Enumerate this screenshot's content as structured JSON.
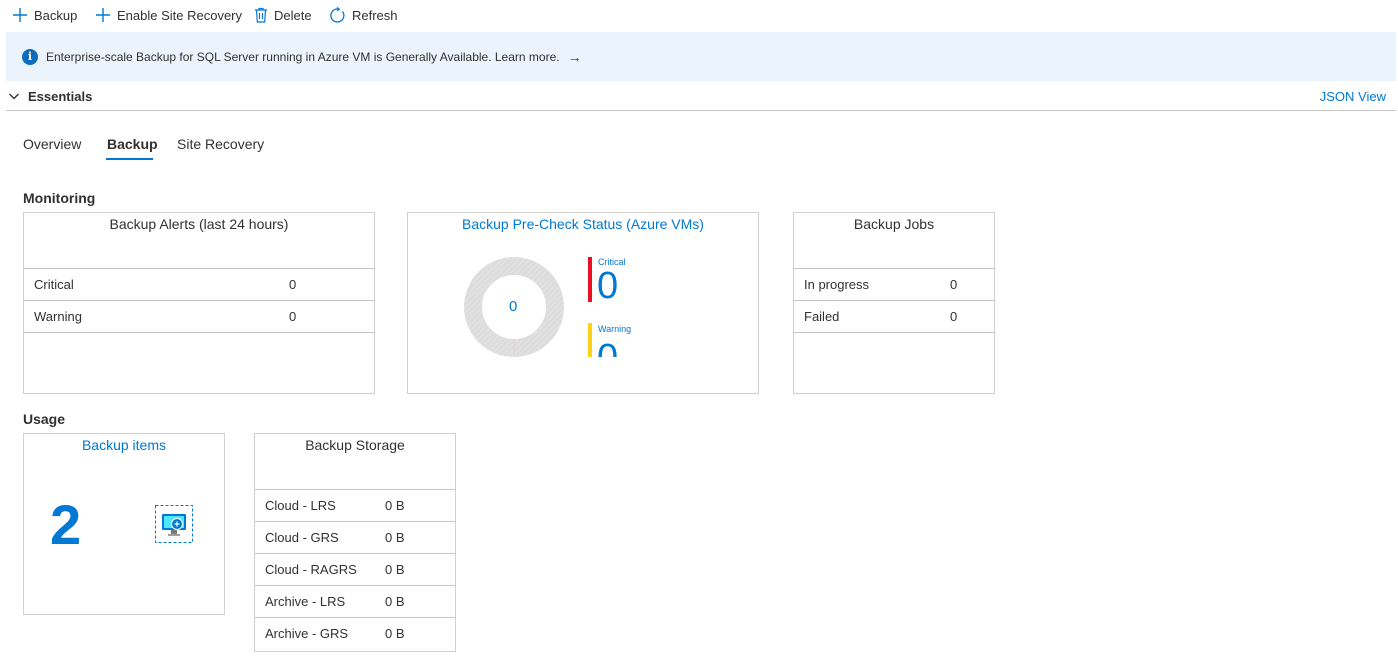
{
  "toolbar": {
    "backup_label": "Backup",
    "enable_site_recovery_label": "Enable Site Recovery",
    "delete_label": "Delete",
    "refresh_label": "Refresh"
  },
  "banner": {
    "message": "Enterprise-scale Backup for SQL Server running in Azure VM is Generally Available. Learn more.",
    "arrow": "→"
  },
  "essentials": {
    "label": "Essentials",
    "json_view": "JSON View"
  },
  "tabs": [
    {
      "label": "Overview",
      "active": false
    },
    {
      "label": "Backup",
      "active": true
    },
    {
      "label": "Site Recovery",
      "active": false
    }
  ],
  "monitoring": {
    "title": "Monitoring",
    "alerts": {
      "title": "Backup Alerts (last 24 hours)",
      "rows": [
        {
          "label": "Critical",
          "value": "0"
        },
        {
          "label": "Warning",
          "value": "0"
        }
      ]
    },
    "precheck": {
      "title": "Backup Pre-Check Status (Azure VMs)",
      "donut_center": "0",
      "critical_label": "Critical",
      "critical_value": "0",
      "warning_label": "Warning",
      "warning_value": "0"
    },
    "jobs": {
      "title": "Backup Jobs",
      "rows": [
        {
          "label": "In progress",
          "value": "0"
        },
        {
          "label": "Failed",
          "value": "0"
        }
      ]
    }
  },
  "usage": {
    "title": "Usage",
    "items": {
      "title": "Backup items",
      "count": "2"
    },
    "storage": {
      "title": "Backup Storage",
      "rows": [
        {
          "label": "Cloud - LRS",
          "value": "0 B"
        },
        {
          "label": "Cloud - GRS",
          "value": "0 B"
        },
        {
          "label": "Cloud - RAGRS",
          "value": "0 B"
        },
        {
          "label": "Archive - LRS",
          "value": "0 B"
        },
        {
          "label": "Archive - GRS",
          "value": "0 B"
        }
      ]
    }
  },
  "colors": {
    "accent": "#0078d4",
    "critical": "#e81123",
    "warning": "#fcd116",
    "banner_bg": "#ebf3fc"
  },
  "icons": [
    "plus-icon",
    "trash-icon",
    "refresh-icon",
    "info-icon",
    "chevron-down-icon",
    "arrow-right-icon",
    "vm-backup-icon"
  ]
}
